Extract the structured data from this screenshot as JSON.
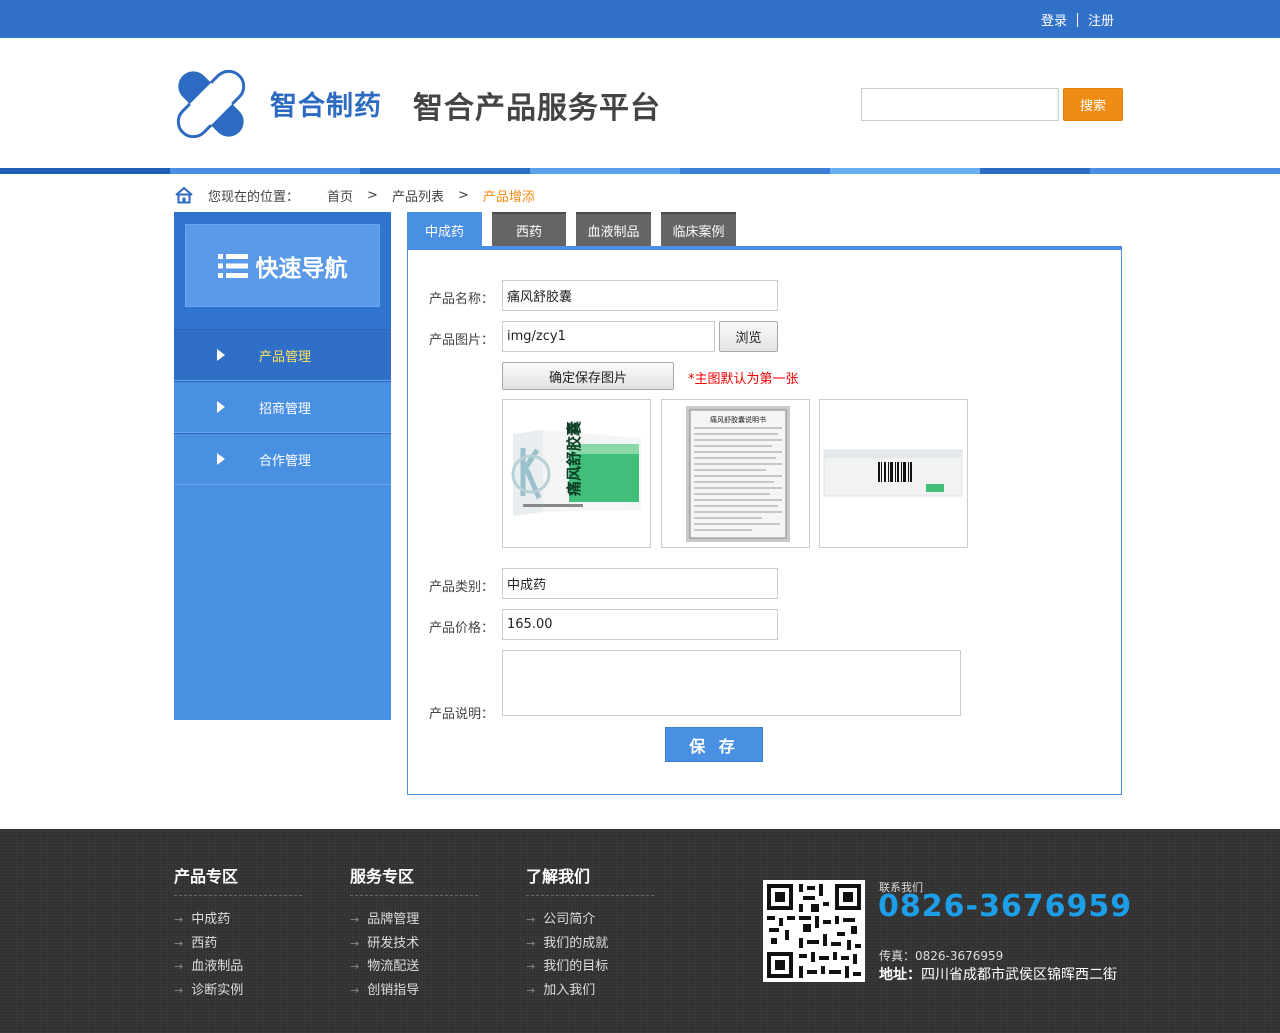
{
  "topbar": {
    "login": "登录",
    "register": "注册"
  },
  "header": {
    "logo_text": "智合制药",
    "platform_title": "智合产品服务平台",
    "search_placeholder": "",
    "search_button": "搜索"
  },
  "breadcrumb": {
    "label": "您现在的位置：",
    "items": [
      "首页",
      "产品列表"
    ],
    "separator": ">",
    "current": "产品增添"
  },
  "sidebar": {
    "title": "快速导航",
    "items": [
      {
        "label": "产品管理",
        "active": true
      },
      {
        "label": "招商管理",
        "active": false
      },
      {
        "label": "合作管理",
        "active": false
      }
    ]
  },
  "tabs": [
    {
      "label": "中成药",
      "active": true
    },
    {
      "label": "西药",
      "active": false
    },
    {
      "label": "血液制品",
      "active": false
    },
    {
      "label": "临床案例",
      "active": false
    }
  ],
  "form": {
    "name_label": "产品名称：",
    "name_value": "痛风舒胶囊",
    "image_label": "产品图片：",
    "image_value": "img/zcy1",
    "browse_button": "浏览",
    "save_images_button": "确定保存图片",
    "main_image_note": "*主图默认为第一张",
    "thumbnails": [
      "product-box-front",
      "instruction-leaflet",
      "product-box-side"
    ],
    "thumbnail_texts": {
      "box_name": "痛风舒胶囊",
      "leaflet_title": "痛风舒胶囊说明书"
    },
    "category_label": "产品类别：",
    "category_value": "中成药",
    "price_label": "产品价格：",
    "price_value": "165.00",
    "desc_label": "产品说明：",
    "desc_value": "",
    "save_button": "保 存"
  },
  "footer": {
    "columns": [
      {
        "title": "产品专区",
        "items": [
          "中成药",
          "西药",
          "血液制品",
          "诊断实例"
        ]
      },
      {
        "title": "服务专区",
        "items": [
          "品牌管理",
          "研发技术",
          "物流配送",
          "创销指导"
        ]
      },
      {
        "title": "了解我们",
        "items": [
          "公司简介",
          "我们的成就",
          "我们的目标",
          "加入我们"
        ]
      }
    ],
    "contact_label": "联系我们",
    "phone": "0826-3676959",
    "fax": "传真：0826-3676959",
    "address_label": "地址：",
    "address": "四川省成都市武侯区锦晖西二街"
  },
  "colors": {
    "topbar": "#3271c9",
    "accent": "#4a90e2",
    "orange": "#f08c13",
    "note_red": "#e00000",
    "phone_blue": "#1d9ee8",
    "footer_bg": "#353535"
  }
}
